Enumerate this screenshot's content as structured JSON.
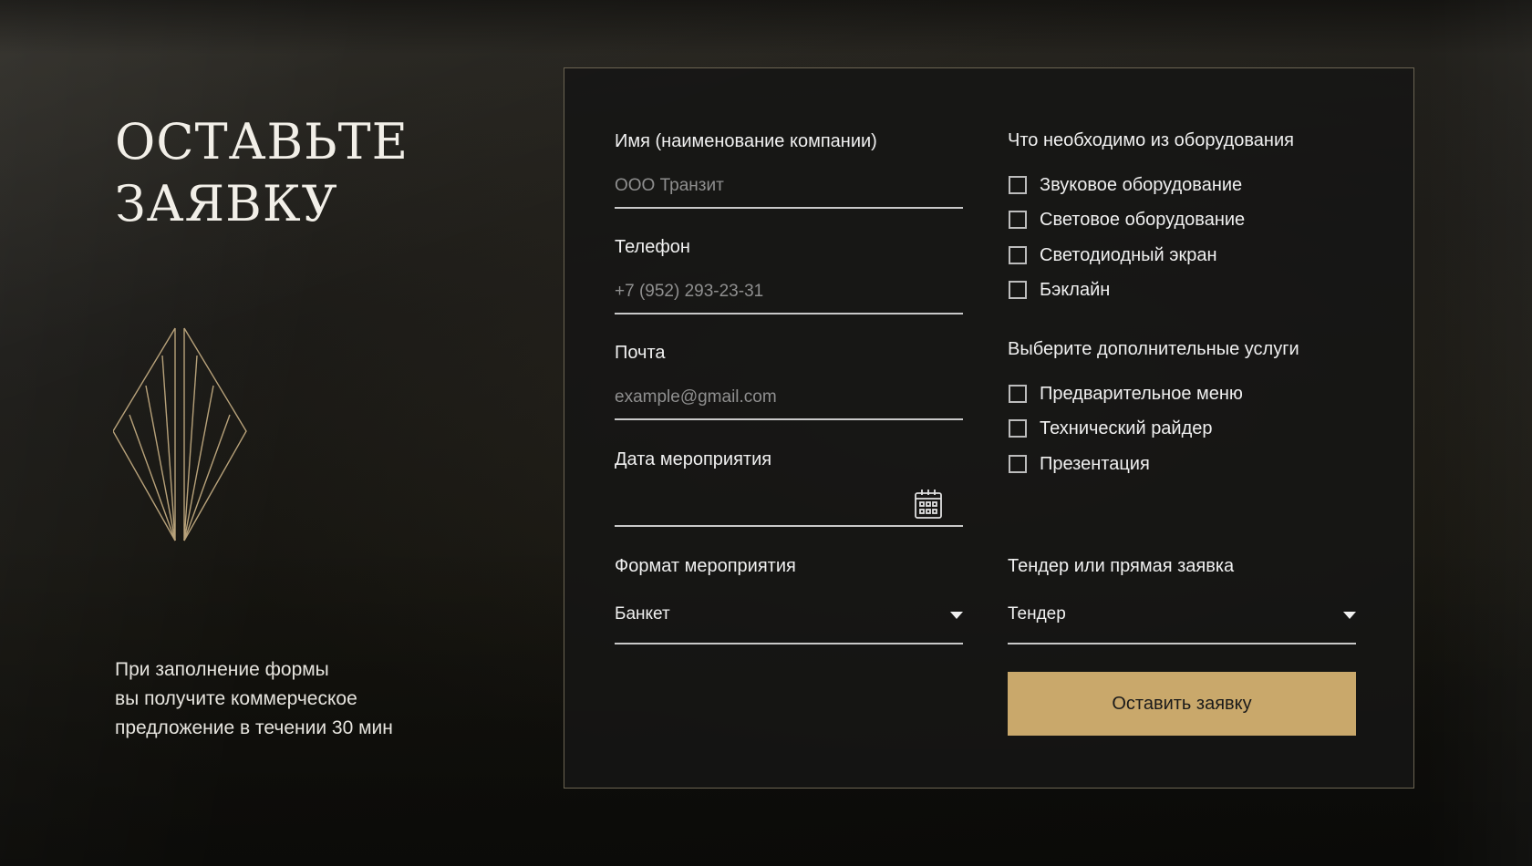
{
  "hero": {
    "heading_line1": "ОСТАВЬТЕ",
    "heading_line2": "ЗАЯВКУ",
    "note_line1": "При заполнение формы",
    "note_line2": "вы получите коммерческое",
    "note_line3": "предложение в течении 30 мин",
    "emblem_icon": "art-deco-fan-emblem"
  },
  "form": {
    "name": {
      "label": "Имя (наименование компании)",
      "placeholder": "ООО Транзит",
      "value": ""
    },
    "phone": {
      "label": "Телефон",
      "placeholder": "+7 (952) 293-23-31",
      "value": ""
    },
    "email": {
      "label": "Почта",
      "placeholder": "example@gmail.com",
      "value": ""
    },
    "date": {
      "label": "Дата мероприятия",
      "value": "",
      "icon": "calendar-icon"
    },
    "format": {
      "label": "Формат мероприятия",
      "value": "Банкет"
    },
    "tender": {
      "label": "Тендер или прямая заявка",
      "value": "Тендер"
    },
    "equipment": {
      "title": "Что необходимо из оборудования",
      "items": [
        {
          "label": "Звуковое оборудование",
          "checked": false
        },
        {
          "label": "Световое оборудование",
          "checked": false
        },
        {
          "label": "Светодиодный экран",
          "checked": false
        },
        {
          "label": "Бэклайн",
          "checked": false
        }
      ]
    },
    "services": {
      "title": "Выберите дополнительные услуги",
      "items": [
        {
          "label": "Предварительное меню",
          "checked": false
        },
        {
          "label": "Технический райдер",
          "checked": false
        },
        {
          "label": "Презентация",
          "checked": false
        }
      ]
    },
    "submit_label": "Оставить заявку"
  },
  "colors": {
    "accent": "#c9a86b",
    "background": "#1a1916",
    "panel_border": "#6b6452",
    "text": "#f0f0f0",
    "placeholder": "#8f8f8f"
  }
}
